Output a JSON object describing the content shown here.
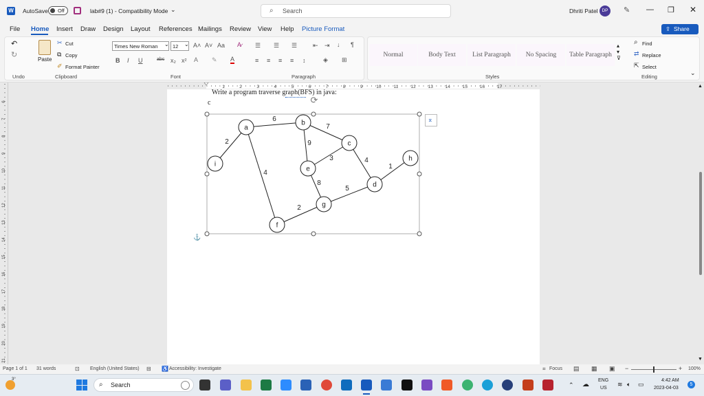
{
  "titlebar": {
    "autosave": "AutoSave",
    "autosave_state": "Off",
    "filename": "lab#9 (1)  -  Compatibility Mode",
    "search_placeholder": "Search",
    "user_name": "Dhriti Patel",
    "user_initials": "DP"
  },
  "menu": {
    "file": "File",
    "home": "Home",
    "insert": "Insert",
    "draw": "Draw",
    "design": "Design",
    "layout": "Layout",
    "references": "References",
    "mailings": "Mailings",
    "review": "Review",
    "view": "View",
    "help": "Help",
    "picture_format": "Picture Format",
    "share": "Share"
  },
  "ribbon": {
    "undo_group": "Undo",
    "clipboard_group": "Clipboard",
    "font_group": "Font",
    "paragraph_group": "Paragraph",
    "styles_group": "Styles",
    "editing_group": "Editing",
    "paste": "Paste",
    "cut": "Cut",
    "copy": "Copy",
    "format_painter": "Format Painter",
    "font_name": "Times New Roman",
    "font_size": "12",
    "styles": [
      "Normal",
      "Body Text",
      "List Paragraph",
      "No Spacing",
      "Table Paragraph"
    ],
    "find": "Find",
    "replace": "Replace",
    "select": "Select"
  },
  "ruler": {
    "h": [
      "1",
      "2",
      "3",
      "4",
      "5",
      "6",
      "7",
      "8",
      "9",
      "10",
      "11",
      "12",
      "13",
      "14",
      "15",
      "16",
      "17"
    ],
    "v": [
      "6",
      "7",
      "8",
      "9",
      "10",
      "11",
      "12",
      "13",
      "14",
      "15",
      "16",
      "17",
      "18",
      "19",
      "20",
      "21"
    ]
  },
  "document": {
    "line1": "Write a program traverse graph(BFS) in java:",
    "line2": "c"
  },
  "graph": {
    "nodes": [
      {
        "id": "a"
      },
      {
        "id": "b"
      },
      {
        "id": "c"
      },
      {
        "id": "d"
      },
      {
        "id": "e"
      },
      {
        "id": "f"
      },
      {
        "id": "g"
      },
      {
        "id": "h"
      },
      {
        "id": "i"
      }
    ],
    "edges": [
      {
        "from": "i",
        "to": "a",
        "w": "2"
      },
      {
        "from": "a",
        "to": "b",
        "w": "6"
      },
      {
        "from": "a",
        "to": "f",
        "w": "4"
      },
      {
        "from": "b",
        "to": "e",
        "w": "9"
      },
      {
        "from": "b",
        "to": "c",
        "w": "7"
      },
      {
        "from": "c",
        "to": "e",
        "w": "3"
      },
      {
        "from": "c",
        "to": "d",
        "w": "4"
      },
      {
        "from": "d",
        "to": "h",
        "w": "1"
      },
      {
        "from": "e",
        "to": "g",
        "w": "8"
      },
      {
        "from": "g",
        "to": "d",
        "w": "5"
      },
      {
        "from": "f",
        "to": "g",
        "w": "2"
      }
    ]
  },
  "status": {
    "page": "Page 1 of 1",
    "words": "31 words",
    "language": "English (United States)",
    "accessibility": "Accessibility: Investigate",
    "focus": "Focus",
    "zoom": "100%"
  },
  "taskbar": {
    "temp": "3°",
    "search": "Search",
    "lang1": "ENG",
    "lang2": "US",
    "time": "4:42 AM",
    "date": "2023-04-03",
    "notif": "5"
  }
}
